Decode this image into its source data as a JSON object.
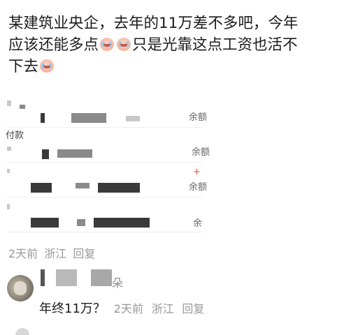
{
  "post": {
    "line_1": "某建筑业央企，去年的11万差不多吧，今年",
    "line_2_a": "应该还能多点",
    "line_2_b": "只是光靠这点工资也活不",
    "line_3": "下去",
    "emoji_names": [
      "crying-face-icon",
      "crying-face-icon",
      "crying-face-icon"
    ]
  },
  "screenshot": {
    "labels": {
      "balance": "余额",
      "payment": "付款",
      "plus": "+",
      "yu": "余"
    }
  },
  "post_meta": {
    "time": "2天前",
    "location": "浙江",
    "reply": "回复"
  },
  "comment": {
    "name_suffix": "朵",
    "text": "年终11万？",
    "time": "2天前",
    "location": "浙江",
    "reply": "回复"
  },
  "colors": {
    "meta_gray": "#999999",
    "red_accent": "#e0544c"
  }
}
